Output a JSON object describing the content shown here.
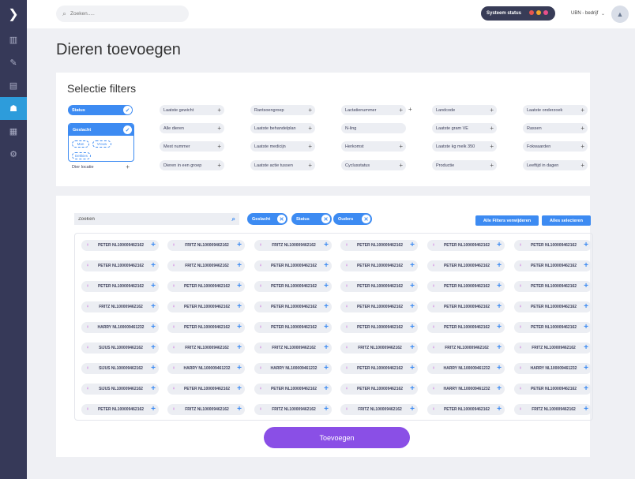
{
  "sidebar": {
    "toggle_icon": "chevron-right-icon",
    "items": [
      {
        "icon": "chart-icon",
        "glyph": "▥"
      },
      {
        "icon": "edit-icon",
        "glyph": "✎"
      },
      {
        "icon": "document-icon",
        "glyph": "▤"
      },
      {
        "icon": "animals-icon",
        "glyph": "☗",
        "active": true
      },
      {
        "icon": "list-icon",
        "glyph": "▦"
      },
      {
        "icon": "settings-icon",
        "glyph": "⚙"
      }
    ]
  },
  "topbar": {
    "search_placeholder": "Zoeken.....",
    "status_label": "Systeem status",
    "status_colors": [
      "#e8554e",
      "#f2a72b",
      "#e84f8a"
    ],
    "company": "UBN - bedrijf"
  },
  "page": {
    "title": "Dieren toevoegen"
  },
  "filters": {
    "title": "Selectie filters",
    "status_chip": "Status",
    "gender": {
      "label": "Geslacht",
      "options": [
        "Man",
        "Vrouw",
        "Dekkies"
      ]
    },
    "dier_locatie": "Dier locatie",
    "chips": [
      {
        "col": 1,
        "row": 0,
        "label": "Laatste gewicht"
      },
      {
        "col": 1,
        "row": 1,
        "label": "Alle dieren"
      },
      {
        "col": 1,
        "row": 2,
        "label": "Mest nummer"
      },
      {
        "col": 1,
        "row": 3,
        "label": "Dieren in een groep"
      },
      {
        "col": 2,
        "row": 0,
        "label": "Rantsoengroep"
      },
      {
        "col": 2,
        "row": 1,
        "label": "Laatste behandelplan"
      },
      {
        "col": 2,
        "row": 2,
        "label": "Laatste medicijn"
      },
      {
        "col": 2,
        "row": 3,
        "label": "Laatste actie tussen"
      },
      {
        "col": 3,
        "row": 0,
        "label": "Lactatienummer"
      },
      {
        "col": 3,
        "row": 1,
        "label": "N-ling"
      },
      {
        "col": 3,
        "row": 2,
        "label": "Herkomst"
      },
      {
        "col": 3,
        "row": 3,
        "label": "Cyclusstatus"
      },
      {
        "col": 4,
        "row": 0,
        "label": "Landcode"
      },
      {
        "col": 4,
        "row": 1,
        "label": "Laatste gram VE"
      },
      {
        "col": 4,
        "row": 2,
        "label": "Laatste kg melk 350"
      },
      {
        "col": 4,
        "row": 3,
        "label": "Productie"
      },
      {
        "col": 5,
        "row": 0,
        "label": "Laatste onderzoek"
      },
      {
        "col": 5,
        "row": 1,
        "label": "Rassen"
      },
      {
        "col": 5,
        "row": 2,
        "label": "Fokwaarden"
      },
      {
        "col": 5,
        "row": 3,
        "label": "Leeftijd in dagen"
      }
    ],
    "no_plus": [
      "N-ling"
    ]
  },
  "animals": {
    "search_label": "Zoeken",
    "active_tags": [
      "Geslacht",
      "Status",
      "Ouders"
    ],
    "remove_filters": "Alle Filters verwijderen",
    "select_all": "Alles selecteren",
    "rows": [
      [
        "PETER NL100009462162",
        "FRITZ NL100009462162",
        "FRITZ NL100009462162",
        "PETER NL100009462162",
        "PETER NL100009462162",
        "PETER NL100009462162"
      ],
      [
        "PETER NL100009462162",
        "FRITZ NL100009462162",
        "PETER NL100009462162",
        "PETER NL100009462162",
        "PETER NL100009462162",
        "PETER NL100009462162"
      ],
      [
        "PETER NL100009462162",
        "PETER NL100009462162",
        "PETER NL100009462162",
        "PETER NL100009462162",
        "PETER NL100009462162",
        "PETER NL100009462162"
      ],
      [
        "FRITZ NL100009462162",
        "PETER NL100009462162",
        "PETER NL100009462162",
        "PETER NL100009462162",
        "PETER NL100009462162",
        "PETER NL100009462162"
      ],
      [
        "HARRY NL100009461232",
        "PETER NL100009462162",
        "PETER NL100009462162",
        "PETER NL100009462162",
        "PETER NL100009462162",
        "PETER NL100009462162"
      ],
      [
        "SIJUS NL100009462162",
        "FRITZ NL100009462162",
        "FRITZ NL100009462162",
        "FRITZ NL100009462162",
        "FRITZ NL100009462162",
        "FRITZ NL100009462162"
      ],
      [
        "SIJUS NL100009462162",
        "HARRY NL100009461232",
        "HARRY NL100009461232",
        "PETER NL100009462162",
        "HARRY NL100009461232",
        "HARRY NL100009461232"
      ],
      [
        "SIJUS NL100009462162",
        "PETER NL100009462162",
        "PETER NL100009462162",
        "PETER NL100009462162",
        "HARRY NL100009461232",
        "PETER NL100009462162"
      ],
      [
        "PETER NL100009462162",
        "FRITZ NL100009462162",
        "FRITZ NL100009462162",
        "FRITZ NL100009462162",
        "PETER NL100009462162",
        "FRITZ NL100009462162"
      ]
    ]
  },
  "submit_label": "Toevoegen",
  "colors": {
    "accent": "#3d8bf2",
    "submit": "#8a4fe6",
    "sidebar": "#363958",
    "female_icon": "#c34fd8"
  }
}
